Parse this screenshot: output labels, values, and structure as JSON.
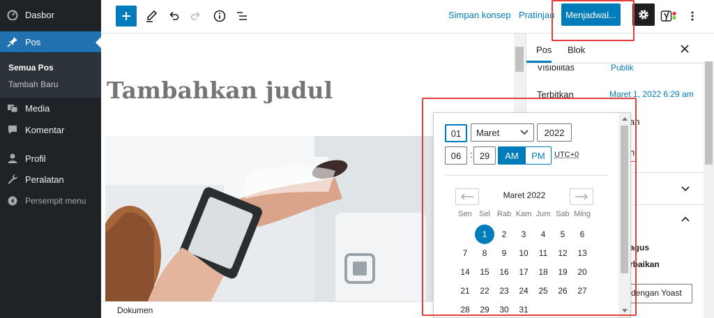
{
  "sidebar": {
    "items": [
      {
        "label": "Dasbor"
      },
      {
        "label": "Pos"
      },
      {
        "label": "Media"
      },
      {
        "label": "Komentar"
      },
      {
        "label": "Profil"
      },
      {
        "label": "Peralatan"
      },
      {
        "label": "Persempit menu"
      }
    ],
    "submenu": [
      {
        "label": "Semua Pos"
      },
      {
        "label": "Tambah Baru"
      }
    ]
  },
  "topbar": {
    "save_draft": "Simpan konsep",
    "preview": "Pratinjau",
    "schedule": "Menjadwal..."
  },
  "editor": {
    "title_placeholder": "Tambahkan judul",
    "footer_label": "Dokumen"
  },
  "settings": {
    "tabs": [
      {
        "label": "Pos"
      },
      {
        "label": "Blok"
      }
    ],
    "visibility_label": "Visibilitas",
    "visibility_value": "Publik",
    "publish_label": "Terbitkan",
    "publish_value": "Maret 1, 2022 6:29 am",
    "partial": [
      "an",
      "n",
      "agus",
      "rbaikan",
      "dengan Yoast"
    ]
  },
  "datepicker": {
    "day": "01",
    "month": "Maret",
    "year": "2022",
    "hour": "06",
    "minute": "29",
    "am": "AM",
    "pm": "PM",
    "timezone": "UTC+0",
    "month_label": "Maret 2022",
    "weekdays": [
      "Sen",
      "Sel",
      "Rab",
      "Kam",
      "Jum",
      "Sab",
      "Ming"
    ],
    "weeks": [
      [
        "",
        "1",
        "2",
        "3",
        "4",
        "5",
        "6"
      ],
      [
        "7",
        "8",
        "9",
        "10",
        "11",
        "12",
        "13"
      ],
      [
        "14",
        "15",
        "16",
        "17",
        "18",
        "19",
        "20"
      ],
      [
        "21",
        "22",
        "23",
        "24",
        "25",
        "26",
        "27"
      ],
      [
        "28",
        "29",
        "30",
        "31",
        "",
        "",
        ""
      ]
    ],
    "selected_day": "1"
  },
  "colors": {
    "accent": "#007cba",
    "admin_bar": "#1d2327",
    "highlight_box": "#e23c3c"
  }
}
